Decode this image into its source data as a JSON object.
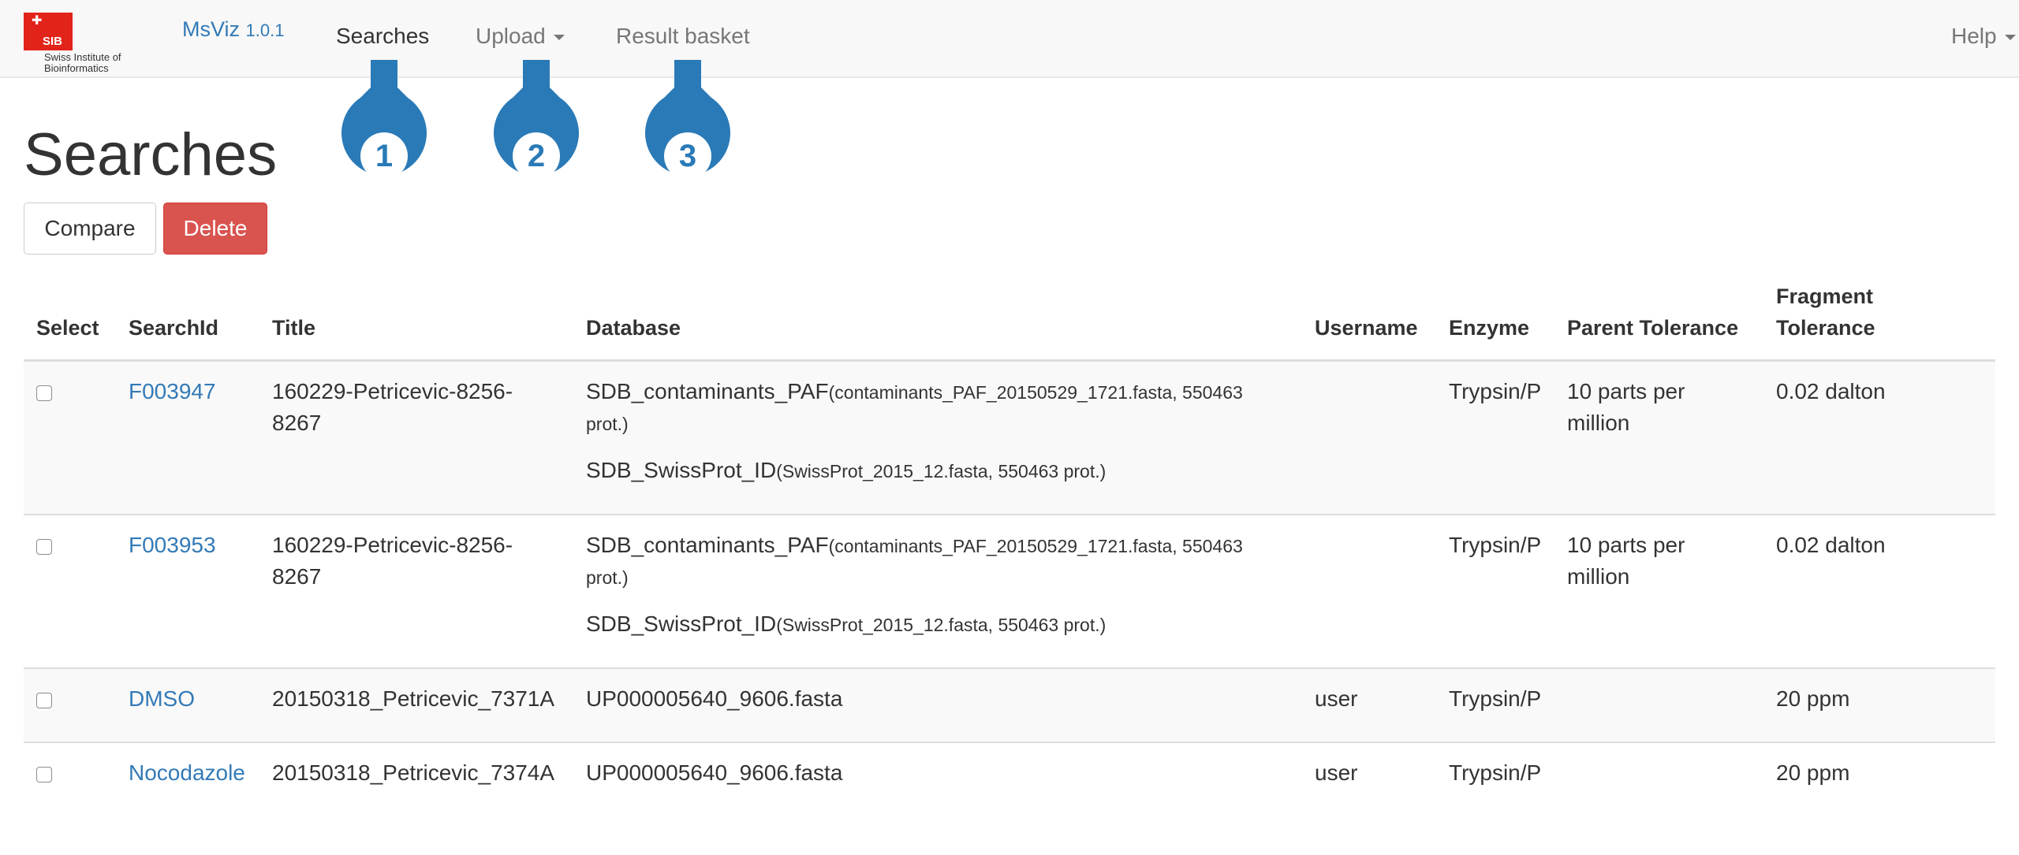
{
  "nav": {
    "logo_text_line1": "Swiss Institute of",
    "logo_text_line2": "Bioinformatics",
    "logo_abbr": "SIB",
    "brand": "MsViz",
    "version": "1.0.1",
    "items": [
      {
        "label": "Searches",
        "active": true
      },
      {
        "label": "Upload",
        "dropdown": true
      },
      {
        "label": "Result basket"
      }
    ],
    "help": "Help"
  },
  "callouts": [
    "1",
    "2",
    "3"
  ],
  "callout_color": "#2a7ab8",
  "page_title": "Searches",
  "buttons": {
    "compare": "Compare",
    "delete": "Delete"
  },
  "table": {
    "headers": {
      "select": "Select",
      "search_id": "SearchId",
      "title": "Title",
      "database": "Database",
      "username": "Username",
      "enzyme": "Enzyme",
      "parent_tolerance": "Parent Tolerance",
      "fragment_tolerance_1": "Fragment",
      "fragment_tolerance_2": "Tolerance"
    },
    "rows": [
      {
        "search_id": "F003947",
        "title_1": "160229-Petricevic-8256-",
        "title_2": "8267",
        "db1_name": "SDB_contaminants_PAF",
        "db1_detail_1": "(contaminants_PAF_20150529_1721.fasta, 550463",
        "db1_detail_2": "prot.)",
        "db2_name": "SDB_SwissProt_ID",
        "db2_detail": "(SwissProt_2015_12.fasta, 550463 prot.)",
        "username": "",
        "enzyme": "Trypsin/P",
        "parent_tol_1": "10 parts per",
        "parent_tol_2": "million",
        "fragment_tol": "0.02 dalton"
      },
      {
        "search_id": "F003953",
        "title_1": "160229-Petricevic-8256-",
        "title_2": "8267",
        "db1_name": "SDB_contaminants_PAF",
        "db1_detail_1": "(contaminants_PAF_20150529_1721.fasta, 550463",
        "db1_detail_2": "prot.)",
        "db2_name": "SDB_SwissProt_ID",
        "db2_detail": "(SwissProt_2015_12.fasta, 550463 prot.)",
        "username": "",
        "enzyme": "Trypsin/P",
        "parent_tol_1": "10 parts per",
        "parent_tol_2": "million",
        "fragment_tol": "0.02 dalton"
      },
      {
        "search_id": "DMSO",
        "title": "20150318_Petricevic_7371A",
        "database": "UP000005640_9606.fasta",
        "username": "user",
        "enzyme": "Trypsin/P",
        "parent_tol": "",
        "fragment_tol": "20 ppm"
      },
      {
        "search_id": "Nocodazole",
        "title": "20150318_Petricevic_7374A",
        "database": "UP000005640_9606.fasta",
        "username": "user",
        "enzyme": "Trypsin/P",
        "parent_tol": "",
        "fragment_tol": "20 ppm"
      }
    ]
  }
}
